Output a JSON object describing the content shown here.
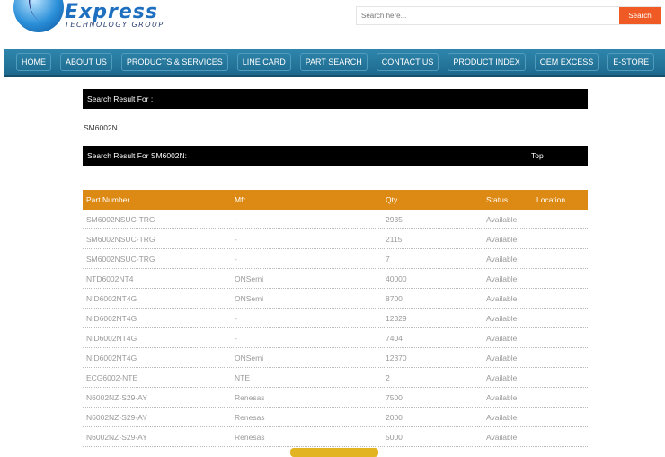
{
  "header": {
    "brand": "Express",
    "tagline": "TECHNOLOGY GROUP",
    "search_placeholder": "Search here...",
    "search_button": "Search"
  },
  "nav": [
    "HOME",
    "ABOUT US",
    "PRODUCTS & SERVICES",
    "LINE CARD",
    "PART SEARCH",
    "CONTACT US",
    "PRODUCT INDEX",
    "OEM EXCESS",
    "E-STORE"
  ],
  "search_result_for_label": "Search Result For :",
  "search_term": "SM6002N",
  "results_bar_label": "Search Result For SM6002N:",
  "top_link": "Top",
  "table": {
    "columns": [
      "Part Number",
      "Mfr",
      "Qty",
      "Status",
      "Location"
    ],
    "rows": [
      [
        "SM6002NSUC-TRG",
        "-",
        "2935",
        "Available",
        ""
      ],
      [
        "SM6002NSUC-TRG",
        "-",
        "2115",
        "Available",
        ""
      ],
      [
        "SM6002NSUC-TRG",
        "-",
        "7",
        "Available",
        ""
      ],
      [
        "NTD6002NT4",
        "ONSemi",
        "40000",
        "Available",
        ""
      ],
      [
        "NID6002NT4G",
        "ONSemi",
        "8700",
        "Available",
        ""
      ],
      [
        "NID6002NT4G",
        "-",
        "12329",
        "Available",
        ""
      ],
      [
        "NID6002NT4G",
        "-",
        "7404",
        "Available",
        ""
      ],
      [
        "NID6002NT4G",
        "ONSemi",
        "12370",
        "Available",
        ""
      ],
      [
        "ECG6002-NTE",
        "NTE",
        "2",
        "Available",
        ""
      ],
      [
        "N6002NZ-S29-AY",
        "Renesas",
        "7500",
        "Available",
        ""
      ],
      [
        "N6002NZ-S29-AY",
        "Renesas",
        "2000",
        "Available",
        ""
      ],
      [
        "N6002NZ-S29-AY",
        "Renesas",
        "5000",
        "Available",
        ""
      ]
    ]
  },
  "colors": {
    "nav": "#2f86ad",
    "table_header": "#dd8a14",
    "search_button": "#f05a24"
  }
}
